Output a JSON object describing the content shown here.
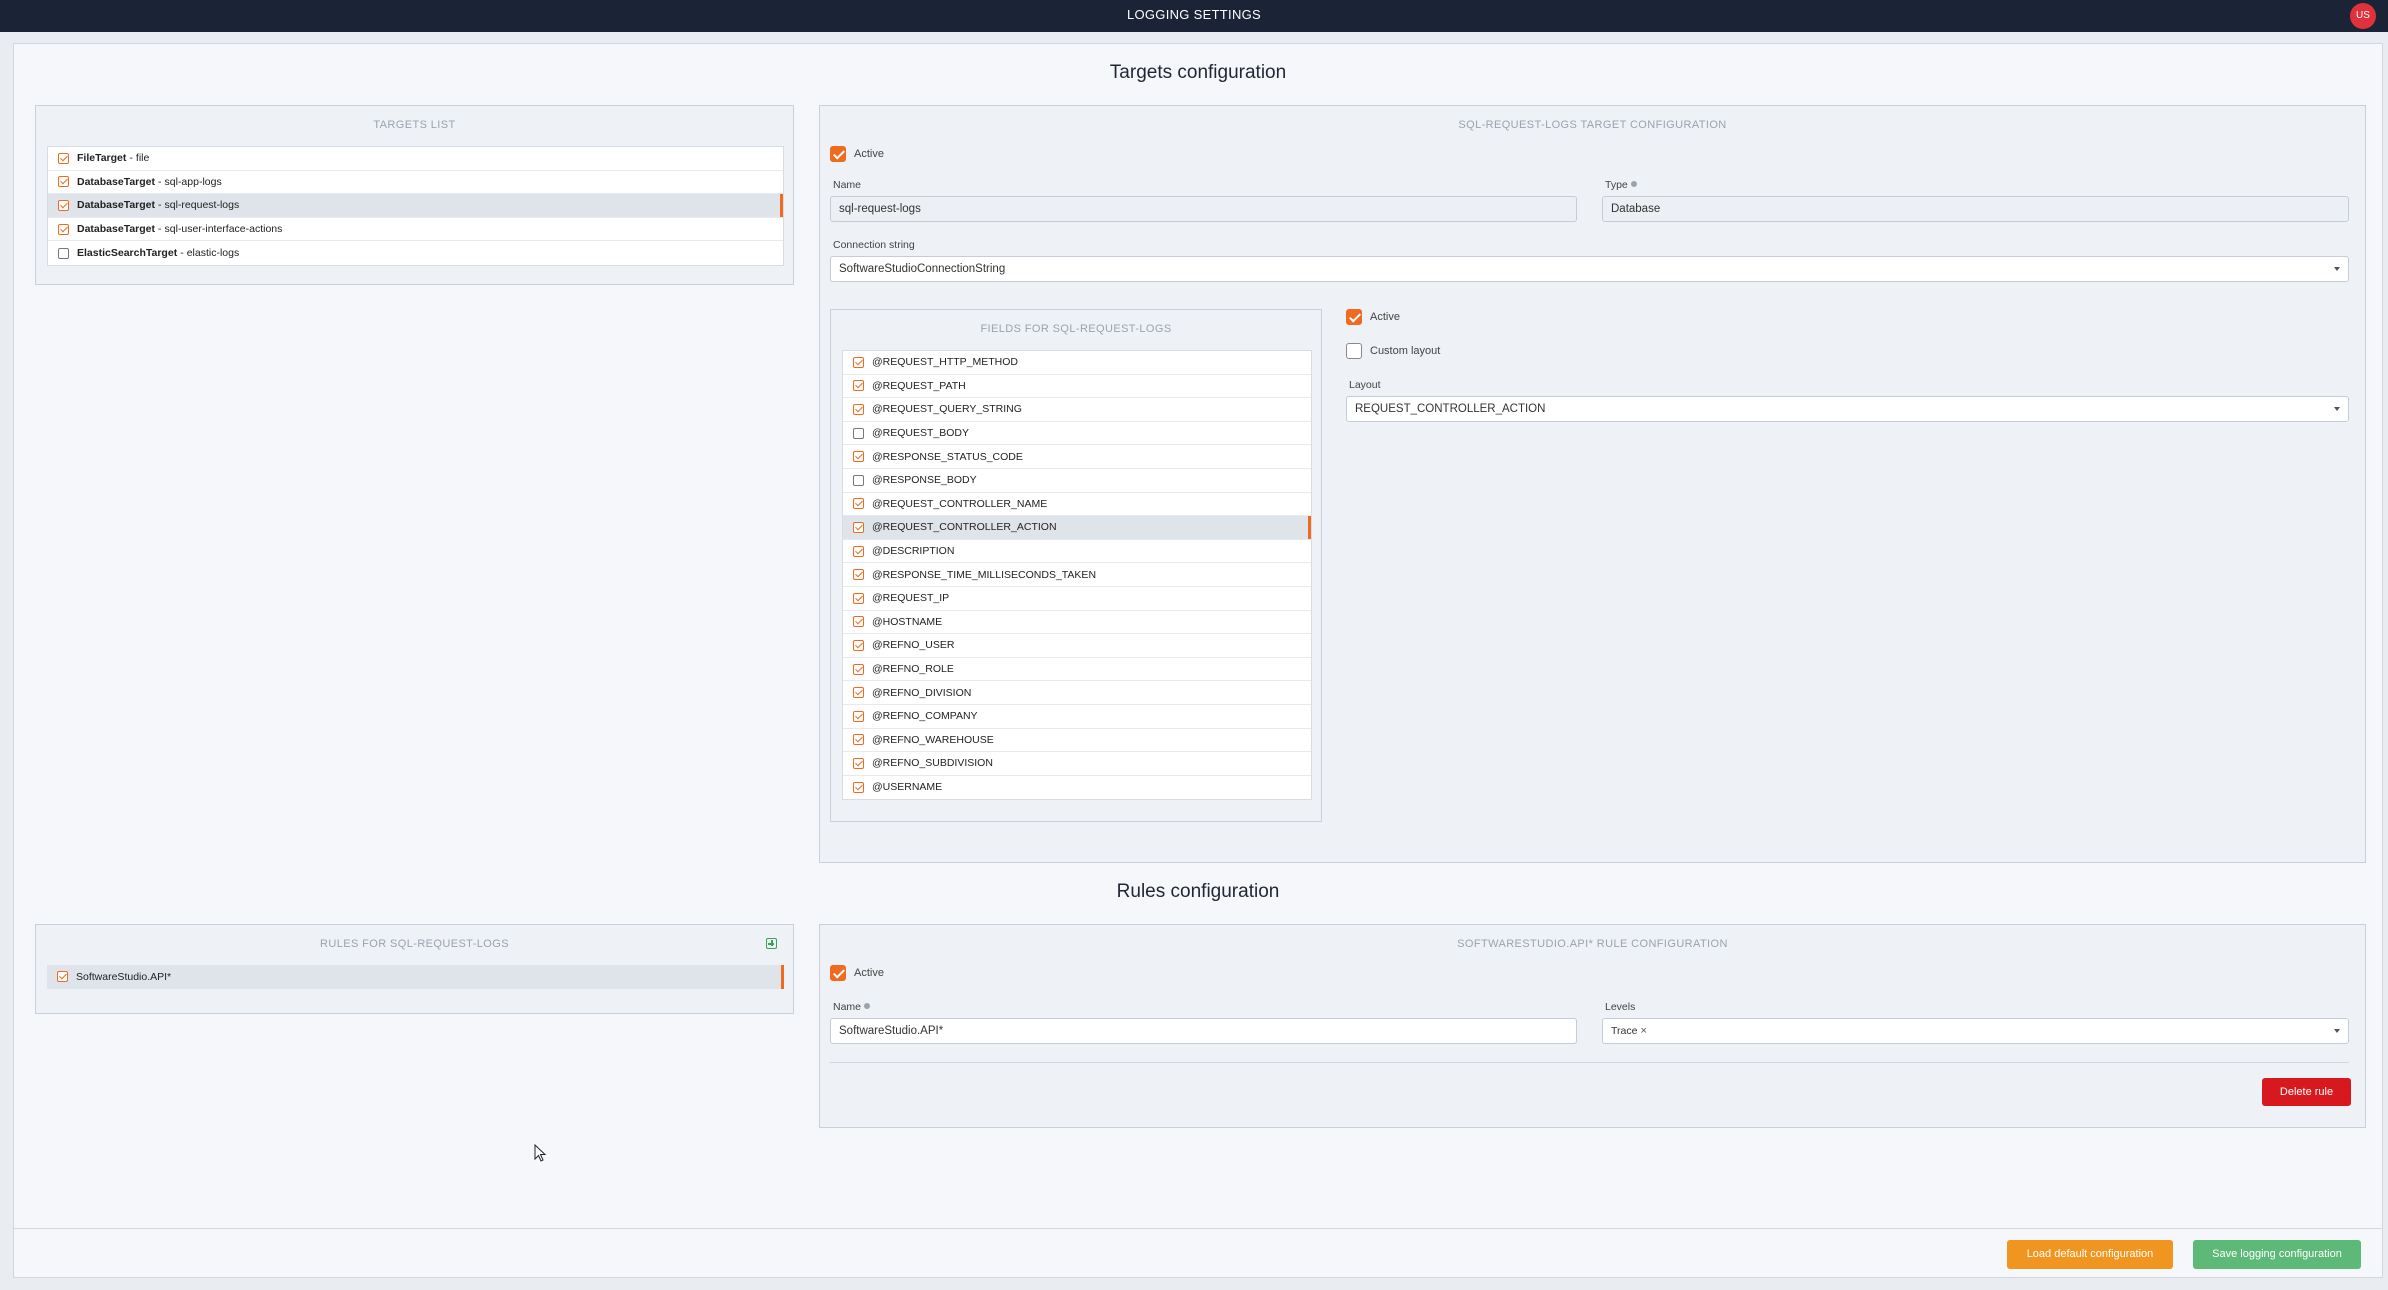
{
  "window": {
    "title": "LOGGING SETTINGS",
    "user_initials": "US"
  },
  "targets_section": {
    "title": "Targets configuration"
  },
  "targets_list": {
    "header": "TARGETS LIST",
    "items": [
      {
        "type": "FileTarget",
        "name": "file",
        "checked": true,
        "selected": false
      },
      {
        "type": "DatabaseTarget",
        "name": "sql-app-logs",
        "checked": true,
        "selected": false
      },
      {
        "type": "DatabaseTarget",
        "name": "sql-request-logs",
        "checked": true,
        "selected": true
      },
      {
        "type": "DatabaseTarget",
        "name": "sql-user-interface-actions",
        "checked": true,
        "selected": false
      },
      {
        "type": "ElasticSearchTarget",
        "name": "elastic-logs",
        "checked": false,
        "selected": false
      }
    ],
    "separator": "-"
  },
  "target_config": {
    "header": "SQL-REQUEST-LOGS TARGET CONFIGURATION",
    "active_label": "Active",
    "active": true,
    "name_label": "Name",
    "name_value": "sql-request-logs",
    "type_label": "Type",
    "type_value": "Database",
    "connection_label": "Connection string",
    "connection_value": "SoftwareStudioConnectionString"
  },
  "fields": {
    "header": "FIELDS FOR SQL-REQUEST-LOGS",
    "items": [
      {
        "label": "@REQUEST_HTTP_METHOD",
        "checked": true,
        "selected": false
      },
      {
        "label": "@REQUEST_PATH",
        "checked": true,
        "selected": false
      },
      {
        "label": "@REQUEST_QUERY_STRING",
        "checked": true,
        "selected": false
      },
      {
        "label": "@REQUEST_BODY",
        "checked": false,
        "selected": false
      },
      {
        "label": "@RESPONSE_STATUS_CODE",
        "checked": true,
        "selected": false
      },
      {
        "label": "@RESPONSE_BODY",
        "checked": false,
        "selected": false
      },
      {
        "label": "@REQUEST_CONTROLLER_NAME",
        "checked": true,
        "selected": false
      },
      {
        "label": "@REQUEST_CONTROLLER_ACTION",
        "checked": true,
        "selected": true
      },
      {
        "label": "@DESCRIPTION",
        "checked": true,
        "selected": false
      },
      {
        "label": "@RESPONSE_TIME_MILLISECONDS_TAKEN",
        "checked": true,
        "selected": false
      },
      {
        "label": "@REQUEST_IP",
        "checked": true,
        "selected": false
      },
      {
        "label": "@HOSTNAME",
        "checked": true,
        "selected": false
      },
      {
        "label": "@REFNO_USER",
        "checked": true,
        "selected": false
      },
      {
        "label": "@REFNO_ROLE",
        "checked": true,
        "selected": false
      },
      {
        "label": "@REFNO_DIVISION",
        "checked": true,
        "selected": false
      },
      {
        "label": "@REFNO_COMPANY",
        "checked": true,
        "selected": false
      },
      {
        "label": "@REFNO_WAREHOUSE",
        "checked": true,
        "selected": false
      },
      {
        "label": "@REFNO_SUBDIVISION",
        "checked": true,
        "selected": false
      },
      {
        "label": "@USERNAME",
        "checked": true,
        "selected": false
      }
    ]
  },
  "field_config": {
    "active_label": "Active",
    "active": true,
    "custom_layout_label": "Custom layout",
    "custom_layout": false,
    "layout_label": "Layout",
    "layout_value": "REQUEST_CONTROLLER_ACTION"
  },
  "rules_section": {
    "title": "Rules configuration"
  },
  "rules_list": {
    "header": "RULES FOR SQL-REQUEST-LOGS",
    "items": [
      {
        "label": "SoftwareStudio.API*",
        "checked": true,
        "selected": true
      }
    ]
  },
  "rule_config": {
    "header": "SOFTWARESTUDIO.API* RULE CONFIGURATION",
    "active_label": "Active",
    "active": true,
    "name_label": "Name",
    "name_value": "SoftwareStudio.API*",
    "levels_label": "Levels",
    "level_tag": "Trace",
    "delete_label": "Delete rule"
  },
  "footer": {
    "load_default_label": "Load default configuration",
    "save_label": "Save logging configuration"
  },
  "colors": {
    "accent": "#f06a1f",
    "topbar": "#1b2437",
    "danger": "#d7191f",
    "warning": "#f0951f",
    "success": "#5cb978"
  }
}
